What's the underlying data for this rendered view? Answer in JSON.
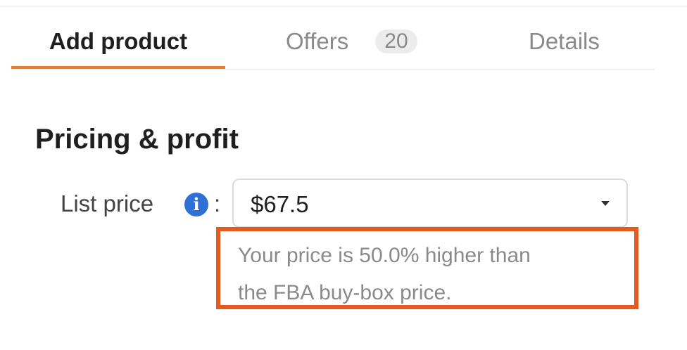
{
  "tabs": {
    "add_product": "Add product",
    "offers": "Offers",
    "offers_count": "20",
    "details": "Details"
  },
  "section": {
    "title": "Pricing & profit"
  },
  "list_price": {
    "label": "List price",
    "colon": ":",
    "info_icon_glyph": "i",
    "value": "$67.5"
  },
  "hint": {
    "line1": "Your price is 50.0% higher than",
    "line2": "the FBA buy-box price."
  },
  "colors": {
    "active_tab_accent": "#e8802b",
    "highlight_border": "#e25b22",
    "info_icon": "#2f6fd6"
  }
}
